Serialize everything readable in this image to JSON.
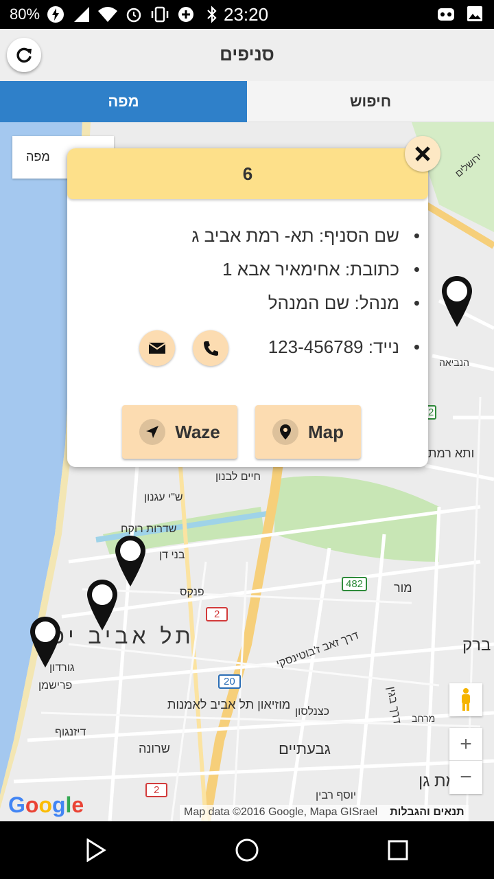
{
  "status_bar": {
    "battery": "80%",
    "time": "23:20",
    "icons": [
      "flash-icon",
      "signal-icon",
      "wifi-icon",
      "alarm-icon",
      "vibrate-icon",
      "data-saver-icon",
      "bluetooth-icon"
    ],
    "right_icons": [
      "app-notification-icon",
      "image-icon"
    ]
  },
  "header": {
    "title": "סניפים"
  },
  "tabs": [
    {
      "label": "מפה",
      "active": true
    },
    {
      "label": "חיפוש",
      "active": false
    }
  ],
  "map": {
    "map_type_label": "מפה",
    "labels": [
      "תל אביב יפו",
      "מוזיאון תל אביב לאמנות",
      "גבעתיים",
      "רמת גן",
      "שדרות רוקח",
      "פנקס",
      "מור",
      "שרונה",
      "דיזנגוף",
      "ש\"י עגנון",
      "חיים לבנון",
      "בני דן",
      "פרישמן",
      "גורדון",
      "דרך זאב ז'בוטינסקי",
      "כצנלסון",
      "דרך בגין",
      "יוסף רבין",
      "ברק",
      "ותא רמת",
      "מרחב",
      "ירושלים",
      "הנביאה"
    ],
    "road_badges": [
      "482",
      "20",
      "2",
      "2",
      "2"
    ],
    "zoom_in": "+",
    "zoom_out": "−",
    "attribution": "Map data ©2016 Google, Mapa GISrael",
    "terms": "תנאים והגבלות",
    "logo": "Google"
  },
  "popup": {
    "title": "6",
    "branch_name": "שם הסניף: תא- רמת אביב ג",
    "address": "כתובת: אחימאיר אבא 1",
    "manager": "מנהל: שם המנהל",
    "mobile": "נייד: 123-456789",
    "waze_label": "Waze",
    "map_label": "Map"
  },
  "colors": {
    "tab_active": "#2f80c9",
    "popup_header": "#fde08a",
    "button_bg": "#fcdcb1"
  }
}
